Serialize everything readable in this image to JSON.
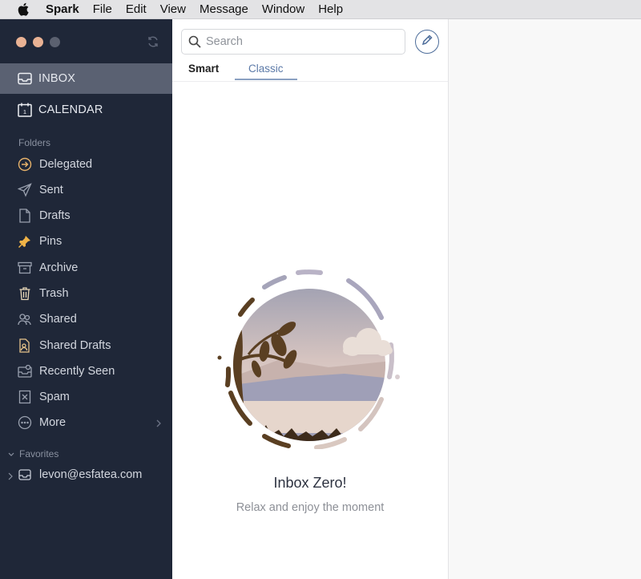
{
  "menubar": {
    "app_name": "Spark",
    "menus": [
      "File",
      "Edit",
      "View",
      "Message",
      "Window",
      "Help"
    ]
  },
  "sidebar": {
    "main": [
      {
        "label": "INBOX",
        "icon": "inbox-icon",
        "selected": true
      },
      {
        "label": "CALENDAR",
        "icon": "calendar-icon",
        "selected": false
      }
    ],
    "folders_label": "Folders",
    "folders": [
      {
        "label": "Delegated",
        "icon": "delegated-icon"
      },
      {
        "label": "Sent",
        "icon": "sent-icon"
      },
      {
        "label": "Drafts",
        "icon": "drafts-icon"
      },
      {
        "label": "Pins",
        "icon": "pin-icon"
      },
      {
        "label": "Archive",
        "icon": "archive-icon"
      },
      {
        "label": "Trash",
        "icon": "trash-icon"
      },
      {
        "label": "Shared",
        "icon": "shared-icon"
      },
      {
        "label": "Shared Drafts",
        "icon": "shared-drafts-icon"
      },
      {
        "label": "Recently Seen",
        "icon": "recently-seen-icon"
      },
      {
        "label": "Spam",
        "icon": "spam-icon"
      },
      {
        "label": "More",
        "icon": "more-icon"
      }
    ],
    "favorites_label": "Favorites",
    "account": "levon@esfatea.com"
  },
  "list": {
    "search_placeholder": "Search",
    "tabs": [
      "Smart",
      "Classic"
    ],
    "active_tab": "Classic",
    "empty_title": "Inbox Zero!",
    "empty_subtitle": "Relax and enjoy the moment"
  },
  "colors": {
    "sidebar_bg": "#1f2738",
    "selected_bg": "#5a6172",
    "accent": "#5c7aa8",
    "traffic": [
      "#e9b294",
      "#e9b294",
      "#5b6170"
    ]
  }
}
